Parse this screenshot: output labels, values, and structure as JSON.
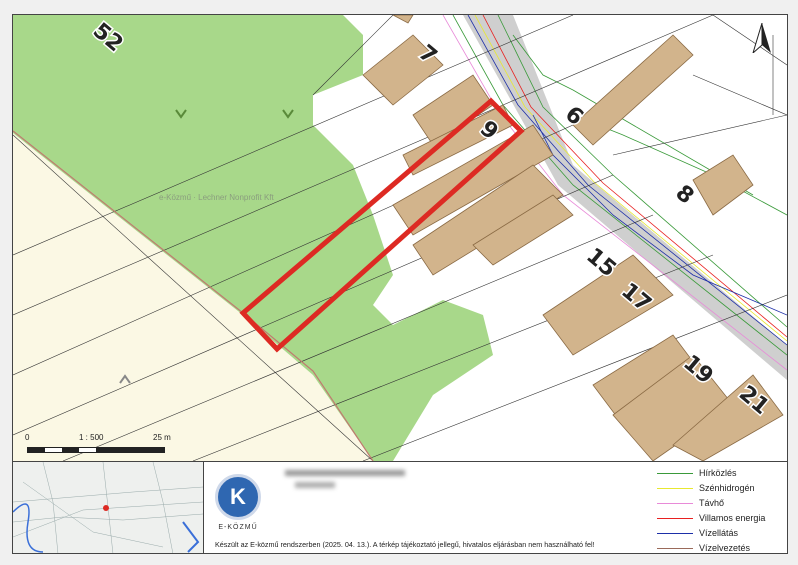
{
  "map": {
    "parcel_numbers": [
      {
        "label": "52",
        "id": "parcel-52"
      },
      {
        "label": "7",
        "id": "parcel-7"
      },
      {
        "label": "9",
        "id": "parcel-9"
      },
      {
        "label": "6",
        "id": "parcel-6"
      },
      {
        "label": "8",
        "id": "parcel-8"
      },
      {
        "label": "15",
        "id": "parcel-15"
      },
      {
        "label": "17",
        "id": "parcel-17"
      },
      {
        "label": "19",
        "id": "parcel-19"
      },
      {
        "label": "21",
        "id": "parcel-21"
      }
    ],
    "watermark": "e-Közmű · Lechner Nonprofit Kft",
    "colors": {
      "green_area": "#a8d88a",
      "field": "#fbf8e4",
      "building": "#d2b48c",
      "building_stroke": "#8a6a44",
      "road": "#c8c8c8",
      "highlight": "#dd2a23"
    }
  },
  "scale": {
    "zero": "0",
    "ratio": "1 : 500",
    "length": "25 m"
  },
  "logo": {
    "letter": "K",
    "name": "E-KÖZMŰ"
  },
  "disclaimer": "Készült az E-közmű rendszerben (2025. 04. 13.). A térkép tájékoztató jellegű, hivatalos eljárásban nem használható fel!",
  "legend": [
    {
      "label": "Hírközlés",
      "color": "#3a9a3a"
    },
    {
      "label": "Szénhidrogén",
      "color": "#e8e830"
    },
    {
      "label": "Távhő",
      "color": "#e88ad8"
    },
    {
      "label": "Villamos energia",
      "color": "#e82020"
    },
    {
      "label": "Vízellátás",
      "color": "#1d2fa8"
    },
    {
      "label": "Vízelvezetés",
      "color": "#9a6a5a"
    }
  ]
}
